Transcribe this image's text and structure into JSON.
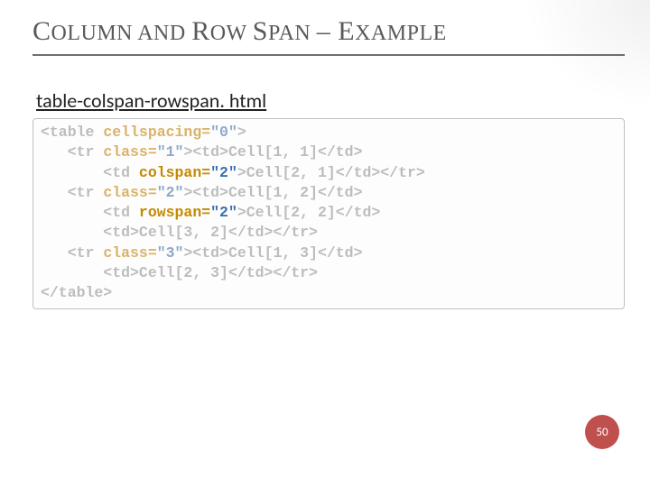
{
  "title_parts": [
    "C",
    "OLUMN AND ",
    "R",
    "OW ",
    "S",
    "PAN ",
    "– E",
    "XAMPLE"
  ],
  "filename": "table-colspan-rowspan. html",
  "code": {
    "l1_a": "<table ",
    "l1_b": "cellspacing=",
    "l1_c": "\"0\"",
    "l1_d": ">",
    "l2_a": "   <tr ",
    "l2_b": "class=",
    "l2_c": "\"1\"",
    "l2_d": "><td>Cell[1, 1]</td>",
    "l3_a": "       <td ",
    "l3_b": "colspan=",
    "l3_c": "\"2\"",
    "l3_d": ">Cell[2, 1]</td></tr>",
    "l4_a": "   <tr ",
    "l4_b": "class=",
    "l4_c": "\"2\"",
    "l4_d": "><td>Cell[1, 2]</td>",
    "l5_a": "       <td ",
    "l5_b": "rowspan=",
    "l5_c": "\"2\"",
    "l5_d": ">Cell[2, 2]</td>",
    "l6": "       <td>Cell[3, 2]</td></tr>",
    "l7_a": "   <tr ",
    "l7_b": "class=",
    "l7_c": "\"3\"",
    "l7_d": "><td>Cell[1, 3]</td>",
    "l8": "       <td>Cell[2, 3]</td></tr>",
    "l9": "</table>"
  },
  "page_number": "50"
}
